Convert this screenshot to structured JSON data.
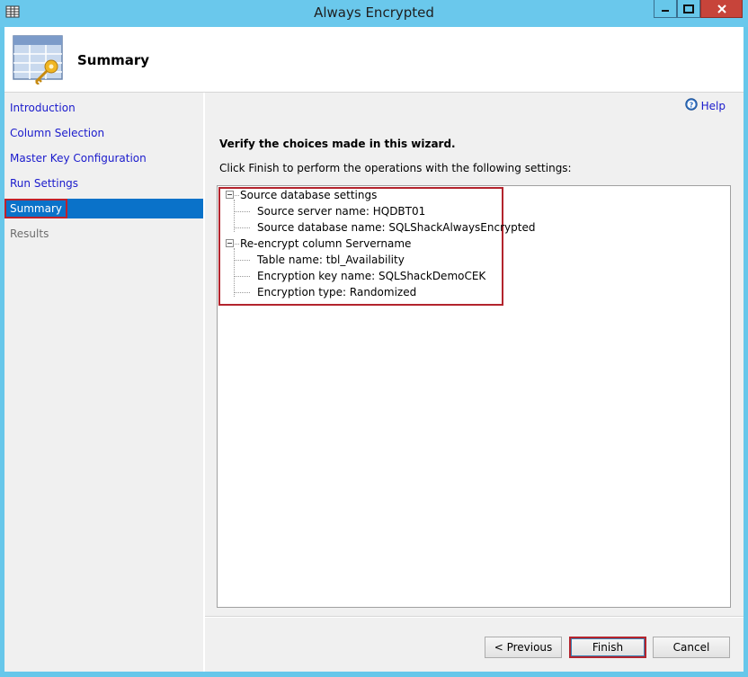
{
  "window": {
    "title": "Always Encrypted",
    "icon": "table-grid-icon"
  },
  "header": {
    "title": "Summary",
    "icon": "table-key-icon"
  },
  "nav": {
    "items": [
      {
        "label": "Introduction",
        "state": "link"
      },
      {
        "label": "Column Selection",
        "state": "link"
      },
      {
        "label": "Master Key Configuration",
        "state": "link"
      },
      {
        "label": "Run Settings",
        "state": "link"
      },
      {
        "label": "Summary",
        "state": "selected"
      },
      {
        "label": "Results",
        "state": "disabled"
      }
    ]
  },
  "panel": {
    "help_label": "Help",
    "verify_heading": "Verify the choices made in this wizard.",
    "instructions": "Click Finish to perform the operations with the following settings:",
    "tree": {
      "groups": [
        {
          "label": "Source database settings",
          "children": [
            "Source server name: HQDBT01",
            "Source database name: SQLShackAlwaysEncrypted"
          ]
        },
        {
          "label": "Re-encrypt column Servername",
          "children": [
            "Table name: tbl_Availability",
            "Encryption key name: SQLShackDemoCEK",
            "Encryption type: Randomized"
          ]
        }
      ]
    }
  },
  "footer": {
    "previous_label": "< Previous",
    "finish_label": "Finish",
    "cancel_label": "Cancel"
  },
  "colors": {
    "frame": "#67c7ea",
    "close_button": "#c7443a",
    "selected_nav": "#0a72c9",
    "link": "#1a1acc",
    "highlight": "#b3242d"
  }
}
